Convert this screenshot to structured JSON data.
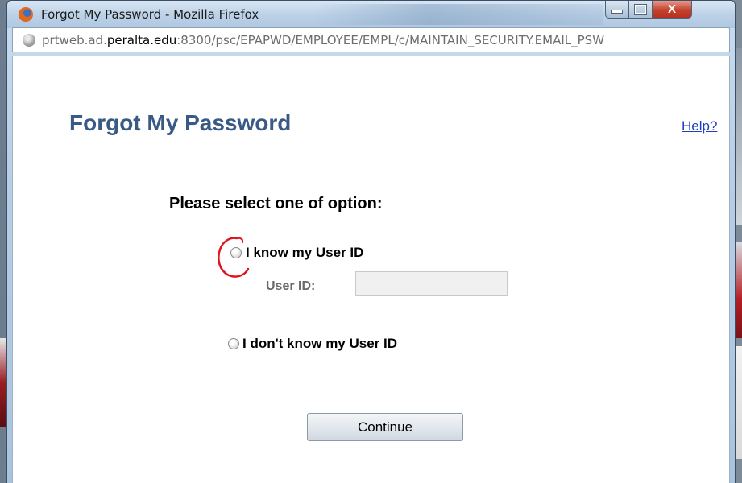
{
  "window": {
    "title": "Forgot My Password - Mozilla Firefox",
    "controls": {
      "minimize": "minimize",
      "maximize": "maximize",
      "close": "X"
    }
  },
  "urlbar": {
    "prefix": "prtweb.ad.",
    "host": "peralta.edu",
    "rest": ":8300/psc/EPAPWD/EMPLOYEE/EMPL/c/MAINTAIN_SECURITY.EMAIL_PSW"
  },
  "page": {
    "title": "Forgot My Password",
    "help_link": "Help?",
    "prompt": "Please select one of option:",
    "options": [
      {
        "label": "I know my User ID",
        "selected": false
      },
      {
        "label": "I don't know my User ID",
        "selected": false
      }
    ],
    "user_id_label": "User ID:",
    "user_id_value": "",
    "continue_label": "Continue"
  },
  "colors": {
    "title_blue": "#3a5a86",
    "link_blue": "#1f3fbf",
    "annotation_red": "#e0141e"
  },
  "icons": [
    "firefox-icon",
    "globe-icon",
    "minimize-icon",
    "maximize-icon",
    "close-icon"
  ]
}
